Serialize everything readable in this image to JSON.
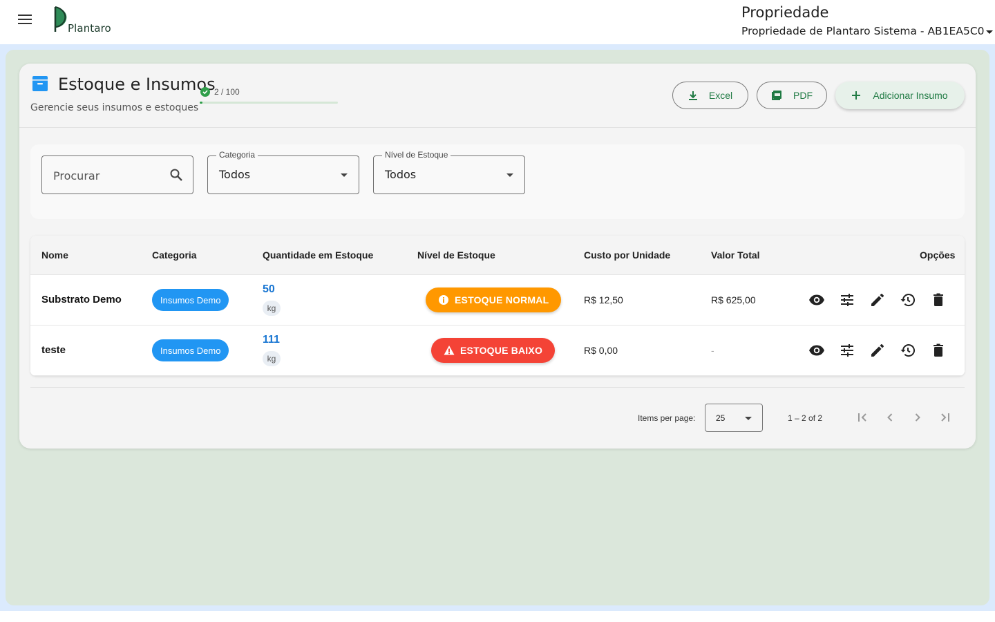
{
  "topbar": {
    "logo_text": "Plantaro",
    "property_title": "Propriedade",
    "property_selected": "Propriedade de Plantaro Sistema - AB1EA5C0"
  },
  "header": {
    "title": "Estoque e Insumos",
    "subtitle": "Gerencie seus insumos e estoques",
    "quota_text": "2 / 100",
    "quota_fraction": 0.02
  },
  "actions": {
    "excel_label": "Excel",
    "pdf_label": "PDF",
    "add_label": "Adicionar Insumo"
  },
  "filters": {
    "search_placeholder": "Procurar",
    "category_label": "Categoria",
    "category_value": "Todos",
    "stock_level_label": "Nível de Estoque",
    "stock_level_value": "Todos"
  },
  "table": {
    "columns": [
      "Nome",
      "Categoria",
      "Quantidade em Estoque",
      "Nível de Estoque",
      "Custo por Unidade",
      "Valor Total",
      "Opções"
    ],
    "rows": [
      {
        "name": "Substrato Demo",
        "category": "Insumos Demo",
        "quantity": "50",
        "unit": "kg",
        "level": "ESTOQUE NORMAL",
        "unit_cost": "R$ 12,50",
        "total": "R$ 625,00"
      },
      {
        "name": "teste",
        "category": "Insumos Demo",
        "quantity": "111",
        "unit": "kg",
        "level": "ESTOQUE BAIXO",
        "unit_cost": "R$ 0,00",
        "total": "-"
      }
    ]
  },
  "pagination": {
    "items_per_page_label": "Items per page:",
    "items_per_page_value": "25",
    "range_label": "1 – 2 of 2"
  },
  "colors": {
    "accent_green": "#1f7a43",
    "chip_blue": "#2196f3",
    "normal_orange": "#ff9800",
    "low_red": "#f44336",
    "qty_blue": "#1976d2"
  }
}
